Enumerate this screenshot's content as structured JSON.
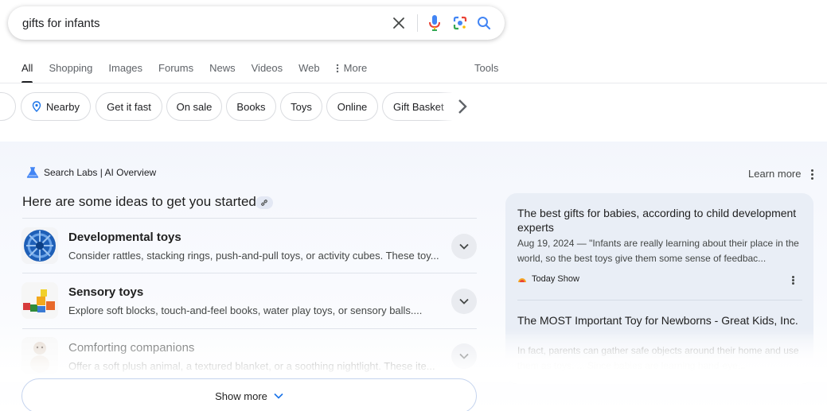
{
  "search": {
    "query": "gifts for infants"
  },
  "tabs": [
    {
      "label": "All",
      "active": true
    },
    {
      "label": "Shopping"
    },
    {
      "label": "Images"
    },
    {
      "label": "Forums"
    },
    {
      "label": "News"
    },
    {
      "label": "Videos"
    },
    {
      "label": "Web"
    },
    {
      "label": "More",
      "icon": "vertical-dots-icon"
    }
  ],
  "tools_label": "Tools",
  "chips": [
    {
      "label": "Nearby",
      "icon": "location-pin-icon"
    },
    {
      "label": "Get it fast"
    },
    {
      "label": "On sale"
    },
    {
      "label": "Books"
    },
    {
      "label": "Toys"
    },
    {
      "label": "Online"
    },
    {
      "label": "Gift Basket"
    }
  ],
  "ai_overview": {
    "header": "Search Labs | AI Overview",
    "learn_more": "Learn more",
    "intro": "Here are some ideas to get you started:",
    "items": [
      {
        "title": "Developmental toys",
        "description": "Consider rattles, stacking rings, push-and-pull toys, or activity cubes. These toy..."
      },
      {
        "title": "Sensory toys",
        "description": "Explore soft blocks, touch-and-feel books, water play toys, or sensory balls...."
      },
      {
        "title": "Comforting companions",
        "description": "Offer a soft plush animal, a textured blanket, or a soothing nightlight. These ite..."
      }
    ],
    "show_more": "Show more"
  },
  "sources": [
    {
      "title": "The best gifts for babies, according to child development experts",
      "snippet": "Aug 19, 2024 — \"Infants are really learning about their place in the world, so the best toys give them some sense of feedbac...",
      "site": "Today Show"
    },
    {
      "title": "The MOST Important Toy for Newborns - Great Kids, Inc.",
      "snippet": "In fact, parents can gather safe objects around their home and use them as toys. ... Since babies are learning hand-eye..."
    }
  ],
  "colors": {
    "google_blue": "#4285f4",
    "google_red": "#ea4335",
    "google_yellow": "#fbbc04",
    "google_green": "#34a853",
    "text_dark": "#202124",
    "text_muted": "#5f6368"
  }
}
